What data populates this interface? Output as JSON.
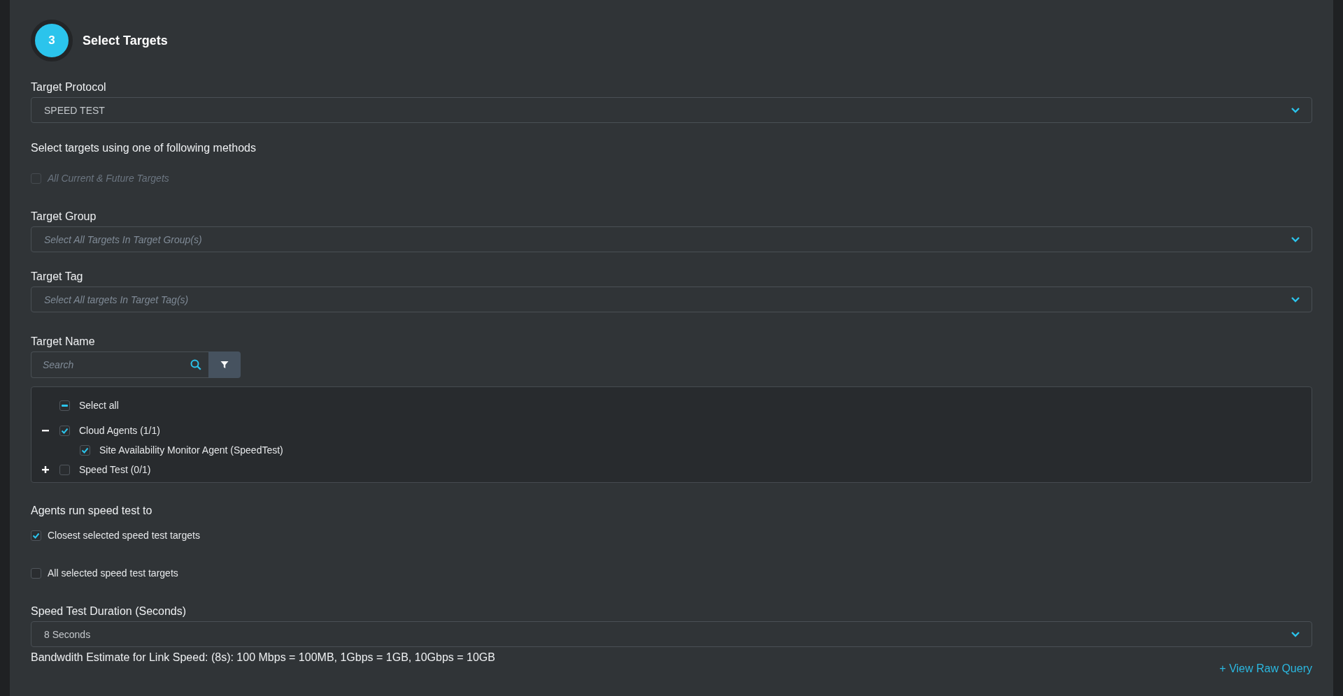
{
  "header": {
    "step": "3",
    "title": "Select Targets"
  },
  "protocol": {
    "label": "Target Protocol",
    "value": "SPEED TEST"
  },
  "methods": {
    "label": "Select targets using one of following methods",
    "all_targets": {
      "label": "All Current & Future Targets",
      "checked": false,
      "disabled": true
    }
  },
  "target_group": {
    "label": "Target Group",
    "placeholder": "Select All Targets In Target Group(s)"
  },
  "target_tag": {
    "label": "Target Tag",
    "placeholder": "Select All targets In Target Tag(s)"
  },
  "target_name": {
    "label": "Target Name",
    "search": {
      "placeholder": "Search"
    },
    "select_all": {
      "label": "Select all",
      "partial": true
    },
    "tree": [
      {
        "label": "Cloud Agents (1/1)",
        "checked": true,
        "expanded": true,
        "children": [
          {
            "label": "Site Availability Monitor Agent (SpeedTest)",
            "checked": true
          }
        ]
      },
      {
        "label": "Speed Test (0/1)",
        "checked": false,
        "expanded": false
      }
    ]
  },
  "agents_run": {
    "label": "Agents run speed test to",
    "options": [
      {
        "label": "Closest selected speed test targets",
        "checked": true
      },
      {
        "label": "All selected speed test targets",
        "checked": false
      }
    ]
  },
  "duration": {
    "label": "Speed Test Duration (Seconds)",
    "value": "8 Seconds",
    "note": "Bandwdith Estimate for Link Speed: (8s): 100 Mbps = 100MB, 1Gbps = 1GB, 10Gbps = 10GB"
  },
  "raw_query_link": "+ View Raw Query"
}
